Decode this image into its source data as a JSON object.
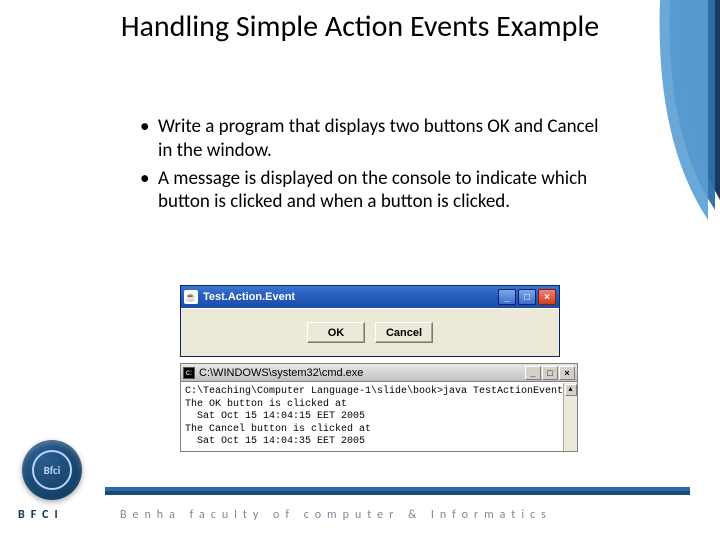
{
  "title": "Handling Simple Action Events Example",
  "bullets": [
    "Write a program that displays two buttons OK and Cancel in the window.",
    "A message is displayed on the console to indicate which button is clicked and when a button is clicked."
  ],
  "java_window": {
    "title": "Test.Action.Event",
    "ok_label": "OK",
    "cancel_label": "Cancel"
  },
  "cmd_window": {
    "title": "C:\\WINDOWS\\system32\\cmd.exe",
    "lines": [
      "C:\\Teaching\\Computer Language-1\\slide\\book>java TestActionEvent",
      "The OK button is clicked at",
      "  Sat Oct 15 14:04:15 EET 2005",
      "The Cancel button is clicked at",
      "  Sat Oct 15 14:04:35 EET 2005"
    ]
  },
  "footer": {
    "bfci": "BFCI",
    "text": "Benha faculty of computer & Informatics",
    "logo_text": "Bfci"
  }
}
